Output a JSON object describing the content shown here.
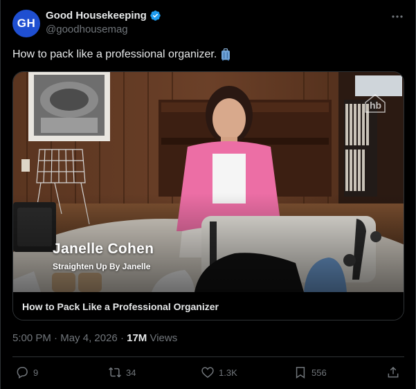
{
  "author": {
    "avatar_text": "GH",
    "display_name": "Good Housekeeping",
    "handle": "@goodhousemag",
    "verified": true
  },
  "tweet": {
    "text": "How to pack like a professional organizer.",
    "emoji_icon": "luggage-icon"
  },
  "card": {
    "overlay_name": "Janelle Cohen",
    "overlay_subtitle": "Straighten Up By Janelle",
    "watermark": "hb",
    "title": "How to Pack Like a Professional Organizer"
  },
  "meta": {
    "time": "5:00 PM",
    "date": "May 4, 2026",
    "views_count": "17M",
    "views_label": "Views"
  },
  "actions": {
    "replies": "9",
    "reposts": "34",
    "likes": "1.3K",
    "bookmarks": "556"
  },
  "colors": {
    "background": "#000000",
    "text": "#e7e9ea",
    "secondary": "#71767b",
    "border": "#2f3336",
    "verified": "#1d9bf0",
    "avatar": "#1f4fd1"
  }
}
